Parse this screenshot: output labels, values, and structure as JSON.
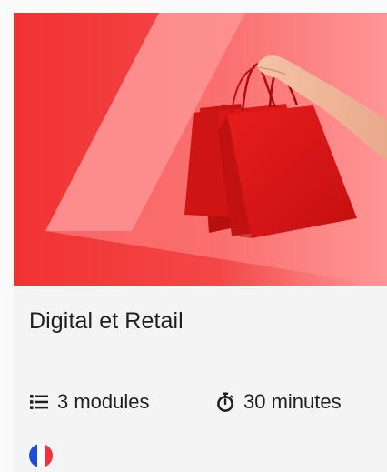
{
  "course": {
    "title": "Digital et Retail",
    "modules_text": "3 modules",
    "duration_text": "30 minutes",
    "language_flag": "flag-france-icon",
    "modules_icon": "list-icon",
    "duration_icon": "stopwatch-icon"
  },
  "colors": {
    "hero_red": "#f23b3b",
    "hero_pink": "#ff8f8f",
    "card_bg": "#f4f4f4",
    "text": "#1f1f1f",
    "flag_blue": "#1d4fd6",
    "flag_white": "#ffffff",
    "flag_red": "#ef3340"
  }
}
